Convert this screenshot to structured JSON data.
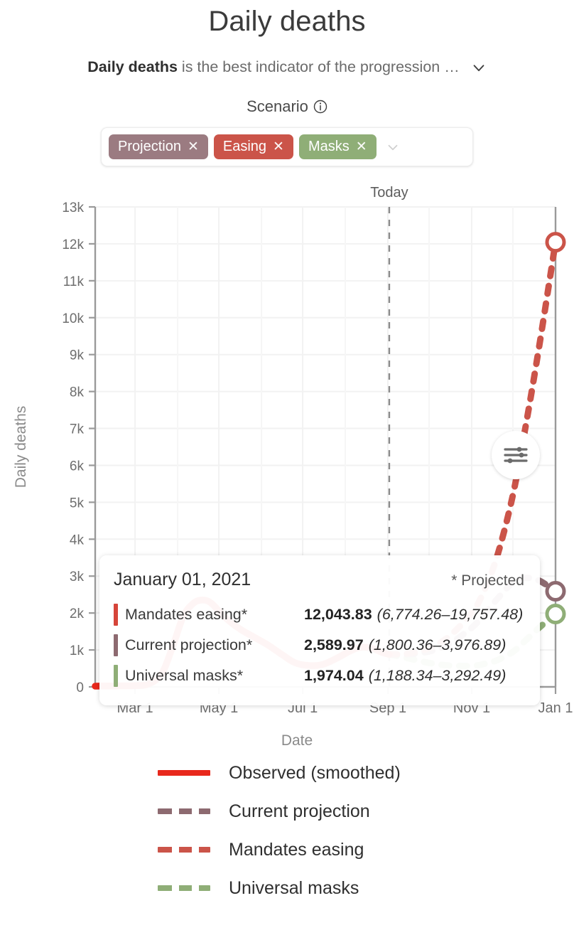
{
  "header": {
    "title": "Daily deaths",
    "subtitle_bold": "Daily deaths",
    "subtitle_rest": " is the best indicator of the progression …",
    "expand_icon": "chevron-down-icon"
  },
  "scenario": {
    "label": "Scenario",
    "info_icon": "info-circle-icon",
    "caret_icon": "chevron-down-icon",
    "chips": [
      {
        "label": "Projection",
        "remove": "✕",
        "color": "#9b7b81"
      },
      {
        "label": "Easing",
        "remove": "✕",
        "color": "#cb5449"
      },
      {
        "label": "Masks",
        "remove": "✕",
        "color": "#8fae77"
      }
    ]
  },
  "settings_button": {
    "icon": "sliders-icon"
  },
  "tooltip": {
    "date": "January 01, 2021",
    "projected_note": "* Projected",
    "rows": [
      {
        "color": "#d6453a",
        "name": "Mandates easing*",
        "value": "12,043.83",
        "ci": "(6,774.26–19,757.48)"
      },
      {
        "color": "#8d6a70",
        "name": "Current projection*",
        "value": "2,589.97",
        "ci": "(1,800.36–3,976.89)"
      },
      {
        "color": "#8fae77",
        "name": "Universal masks*",
        "value": "1,974.04",
        "ci": "(1,188.34–3,292.49)"
      }
    ]
  },
  "legend": {
    "items": [
      {
        "label": "Observed (smoothed)",
        "color": "#e8281c",
        "style": "solid"
      },
      {
        "label": "Current projection",
        "color": "#8d6a70",
        "style": "dashed"
      },
      {
        "label": "Mandates easing",
        "color": "#cb5449",
        "style": "dashed"
      },
      {
        "label": "Universal masks",
        "color": "#8fae77",
        "style": "dashed"
      }
    ]
  },
  "chart_data": {
    "type": "line",
    "title": "Daily deaths",
    "xlabel": "Date",
    "ylabel": "Daily deaths",
    "ylim": [
      0,
      13000
    ],
    "yticks": [
      0,
      1000,
      2000,
      3000,
      4000,
      5000,
      6000,
      7000,
      8000,
      9000,
      10000,
      11000,
      12000,
      13000
    ],
    "ytick_labels": [
      "0",
      "1k",
      "2k",
      "3k",
      "4k",
      "5k",
      "6k",
      "7k",
      "8k",
      "9k",
      "10k",
      "11k",
      "12k",
      "13k"
    ],
    "xlim": [
      "2020-02-01",
      "2021-01-01"
    ],
    "xticks": [
      "2020-03-01",
      "2020-05-01",
      "2020-07-01",
      "2020-09-01",
      "2020-11-01",
      "2021-01-01"
    ],
    "xtick_labels": [
      "Mar 1",
      "May 1",
      "Jul 1",
      "Sep 1",
      "Nov 1",
      "Jan 1"
    ],
    "grid": true,
    "legend_position": "bottom",
    "annotations": [
      {
        "text": "Today",
        "x": "2020-09-02",
        "type": "vline-dashed"
      }
    ],
    "series": [
      {
        "name": "Observed (smoothed)",
        "color": "#e8281c",
        "style": "solid",
        "x": [
          "2020-02-01",
          "2020-02-15",
          "2020-03-01",
          "2020-03-10",
          "2020-03-20",
          "2020-03-28",
          "2020-04-05",
          "2020-04-12",
          "2020-04-18",
          "2020-04-25",
          "2020-05-05",
          "2020-05-15",
          "2020-05-25",
          "2020-06-05",
          "2020-06-15",
          "2020-06-25",
          "2020-07-05",
          "2020-07-15",
          "2020-07-25",
          "2020-08-05",
          "2020-08-12",
          "2020-08-20",
          "2020-08-28",
          "2020-09-02"
        ],
        "values": [
          20,
          25,
          35,
          70,
          330,
          1050,
          1900,
          2250,
          2350,
          2280,
          1900,
          1600,
          1380,
          1150,
          900,
          660,
          580,
          600,
          760,
          980,
          1070,
          1050,
          930,
          880
        ]
      },
      {
        "name": "Current projection",
        "color": "#8d6a70",
        "style": "dashed",
        "x": [
          "2020-09-02",
          "2020-09-15",
          "2020-10-01",
          "2020-10-15",
          "2020-11-01",
          "2020-11-10",
          "2020-11-20",
          "2020-12-01",
          "2020-12-10",
          "2020-12-20",
          "2021-01-01"
        ],
        "values": [
          880,
          880,
          960,
          1150,
          1600,
          1960,
          2400,
          2830,
          2950,
          2880,
          2589.97
        ],
        "endpoint_marker": true,
        "ci_at_end": [
          1800.36,
          3976.89
        ]
      },
      {
        "name": "Mandates easing",
        "color": "#cb5449",
        "style": "dashed",
        "x": [
          "2020-09-02",
          "2020-09-15",
          "2020-10-01",
          "2020-10-15",
          "2020-11-01",
          "2020-11-10",
          "2020-11-20",
          "2020-12-01",
          "2020-12-10",
          "2020-12-20",
          "2021-01-01"
        ],
        "values": [
          880,
          900,
          1050,
          1350,
          2000,
          2600,
          3600,
          5200,
          7000,
          9200,
          12043.83
        ],
        "endpoint_marker": true,
        "ci_at_end": [
          6774.26,
          19757.48
        ]
      },
      {
        "name": "Universal masks",
        "color": "#8fae77",
        "style": "dashed",
        "x": [
          "2020-09-02",
          "2020-09-15",
          "2020-10-01",
          "2020-10-15",
          "2020-11-01",
          "2020-11-10",
          "2020-11-20",
          "2020-12-01",
          "2020-12-10",
          "2020-12-20",
          "2021-01-01"
        ],
        "values": [
          880,
          780,
          650,
          580,
          570,
          620,
          730,
          950,
          1250,
          1600,
          1974.04
        ],
        "endpoint_marker": true,
        "ci_at_end": [
          1188.34,
          3292.49
        ]
      }
    ]
  }
}
